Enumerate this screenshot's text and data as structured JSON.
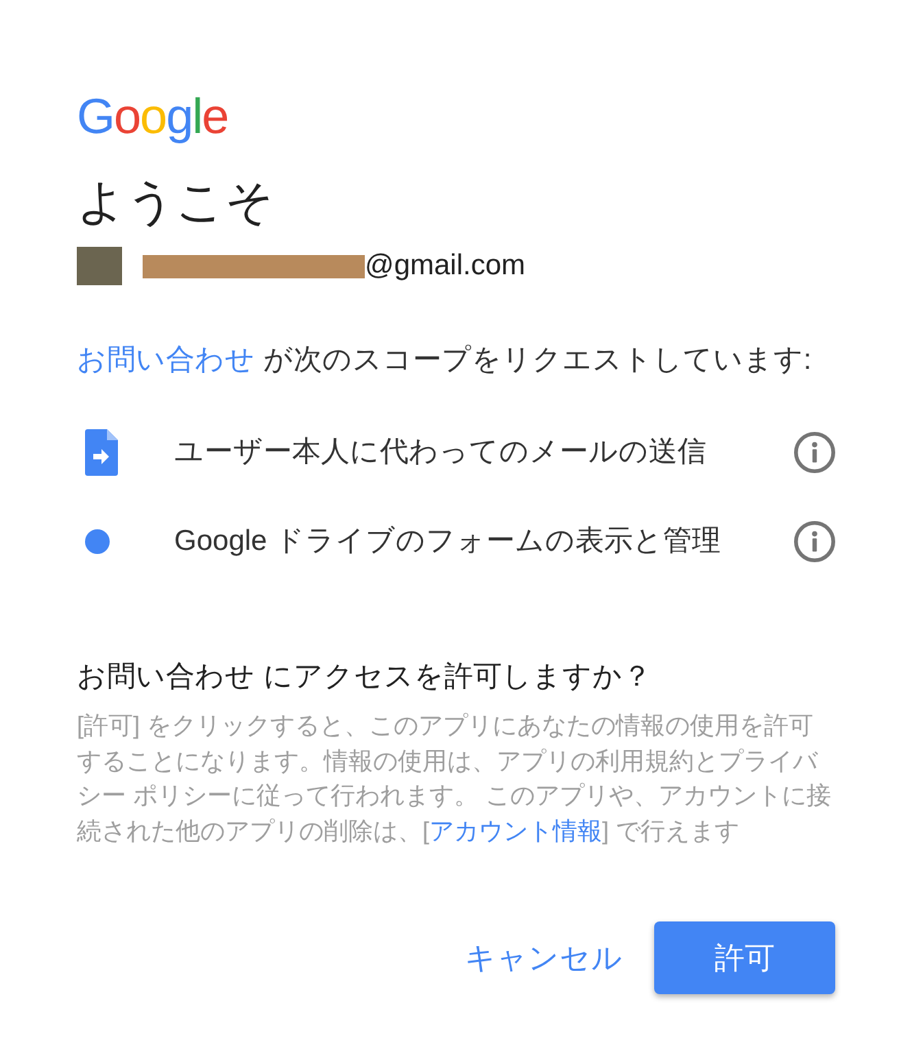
{
  "logo": [
    {
      "text": "G",
      "color": "#4285f4"
    },
    {
      "text": "o",
      "color": "#ea4335"
    },
    {
      "text": "o",
      "color": "#fbbc05"
    },
    {
      "text": "g",
      "color": "#4285f4"
    },
    {
      "text": "l",
      "color": "#34a853"
    },
    {
      "text": "e",
      "color": "#ea4335"
    }
  ],
  "welcome": {
    "title": "ようこそ",
    "email": "@gmail.com"
  },
  "request": {
    "app": "お問い合わせ",
    "text": "が次のスコープをリクエストしています:"
  },
  "scopes": [
    {
      "kind": "document",
      "text": "ユーザー本人に代わってのメールの送信"
    },
    {
      "kind": "dot",
      "text": "Google ドライブのフォームの表示と管理"
    }
  ],
  "consent": {
    "question": "お問い合わせ にアクセスを許可しますか？",
    "before": "[許可] をクリックすると、このアプリにあなたの情報の使用を許可することになります。情報の使用は、アプリの利用規約とプライバシー ポリシーに従って行われます。 このアプリや、アカウントに接続された他のアプリの削除は、[",
    "link": "アカウント情報",
    "after": "] で行えます"
  },
  "buttons": [
    {
      "kind": "text",
      "label": "キャンセル"
    },
    {
      "kind": "primary",
      "label": "許可"
    }
  ]
}
